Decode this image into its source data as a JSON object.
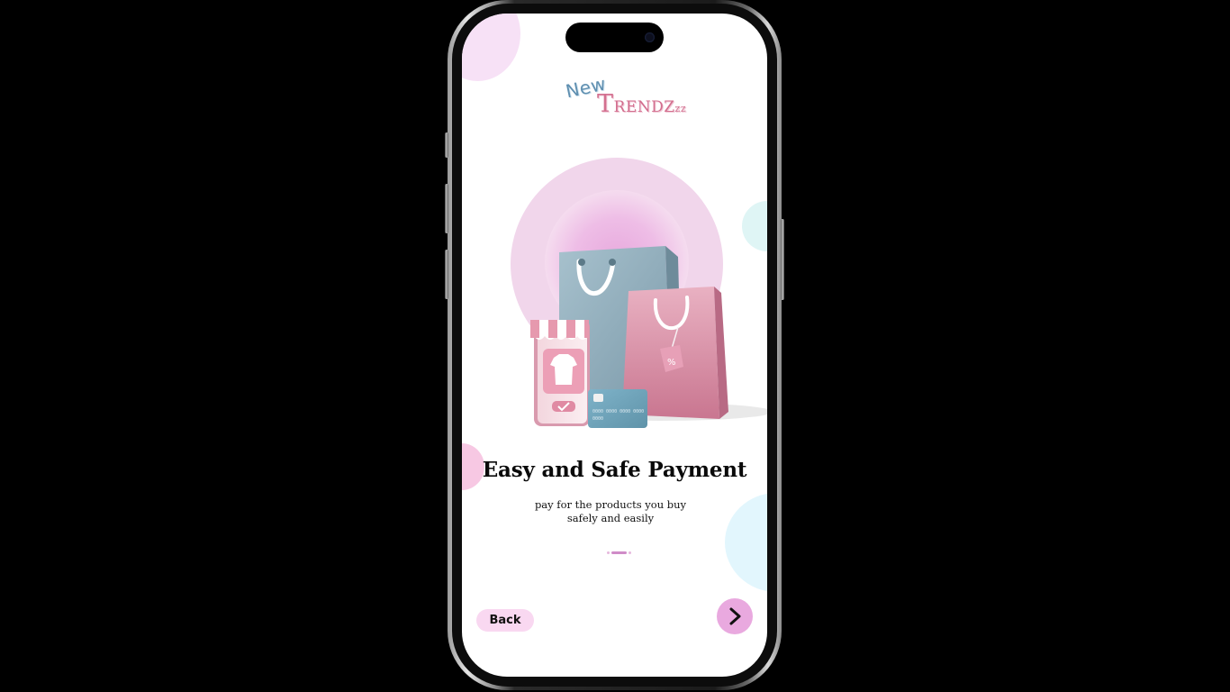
{
  "onboarding": {
    "logo": {
      "line1": "New",
      "line2_cap": "T",
      "line2_rest": "RENDZ",
      "line2_tail": "zz"
    },
    "headline": "Easy and Safe Payment",
    "subtitle_line1": "pay for the products you buy",
    "subtitle_line2": "safely and easily",
    "pager": {
      "total": 3,
      "active_index": 1
    },
    "back_label": "Back",
    "next_icon": "chevron-right-icon",
    "card_number": "0000 0000 0000 0000",
    "card_number_tail": "0000"
  },
  "colors": {
    "accent_pink": "#e9a9df",
    "back_button_bg": "#f9d8f1",
    "bag_blue": "#8eabb9",
    "bag_pink": "#d98aa3"
  }
}
